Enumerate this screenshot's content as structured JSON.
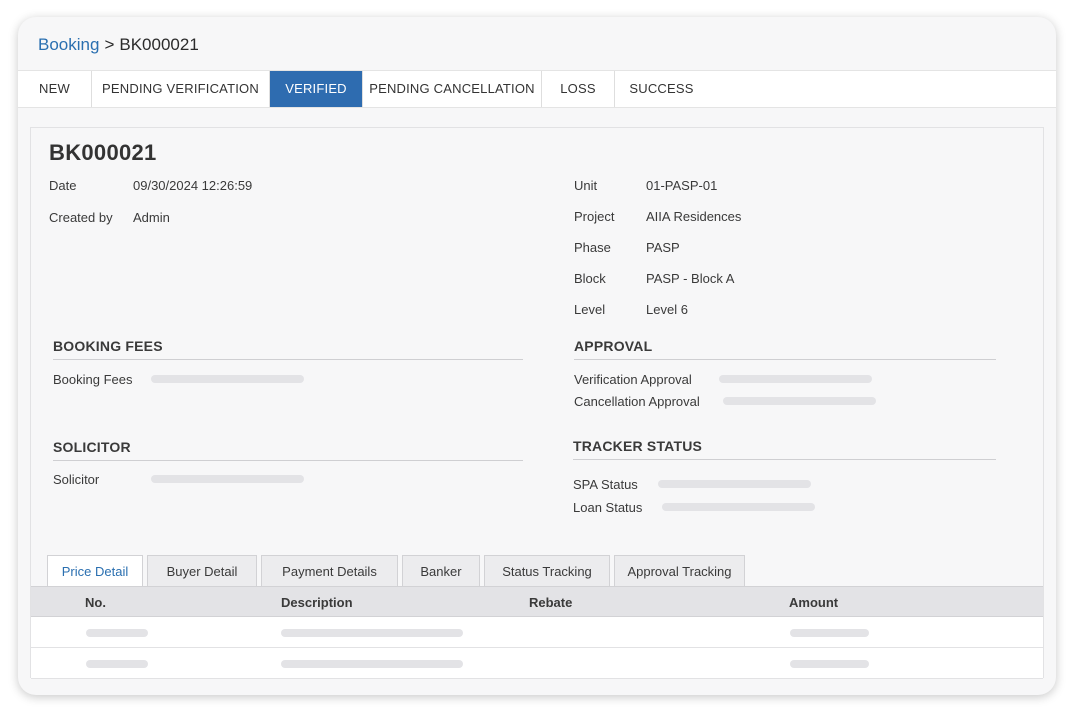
{
  "breadcrumb": {
    "root": "Booking",
    "separator": ">",
    "current": "BK000021"
  },
  "status_tabs": [
    {
      "label": "NEW",
      "active": false
    },
    {
      "label": "PENDING VERIFICATION",
      "active": false
    },
    {
      "label": "VERIFIED",
      "active": true
    },
    {
      "label": "PENDING CANCELLATION",
      "active": false
    },
    {
      "label": "LOSS",
      "active": false
    },
    {
      "label": "SUCCESS",
      "active": false
    }
  ],
  "booking": {
    "id": "BK000021",
    "left_fields": [
      {
        "label": "Date",
        "value": "09/30/2024 12:26:59"
      },
      {
        "label": "Created by",
        "value": "Admin"
      }
    ],
    "right_fields": [
      {
        "label": "Unit",
        "value": "01-PASP-01"
      },
      {
        "label": "Project",
        "value": "AIIA Residences"
      },
      {
        "label": "Phase",
        "value": "PASP"
      },
      {
        "label": "Block",
        "value": "PASP - Block A"
      },
      {
        "label": "Level",
        "value": "Level 6"
      }
    ]
  },
  "sections": {
    "booking_fees": {
      "heading": "BOOKING FEES",
      "fields": [
        "Booking Fees"
      ]
    },
    "approval": {
      "heading": "APPROVAL",
      "fields": [
        "Verification Approval",
        "Cancellation Approval"
      ]
    },
    "solicitor": {
      "heading": "SOLICITOR",
      "fields": [
        "Solicitor"
      ]
    },
    "tracker_status": {
      "heading": "TRACKER STATUS",
      "fields": [
        "SPA Status",
        "Loan Status"
      ]
    }
  },
  "detail_tabs": [
    {
      "label": "Price Detail",
      "active": true
    },
    {
      "label": "Buyer Detail",
      "active": false
    },
    {
      "label": "Payment Details",
      "active": false
    },
    {
      "label": "Banker",
      "active": false
    },
    {
      "label": "Status Tracking",
      "active": false
    },
    {
      "label": "Approval Tracking",
      "active": false
    }
  ],
  "price_table": {
    "columns": [
      "No.",
      "Description",
      "Rebate",
      "Amount"
    ]
  },
  "colors": {
    "accent": "#2e6cb0",
    "link": "#2a6fb0",
    "skeleton": "#e3e3e6"
  }
}
